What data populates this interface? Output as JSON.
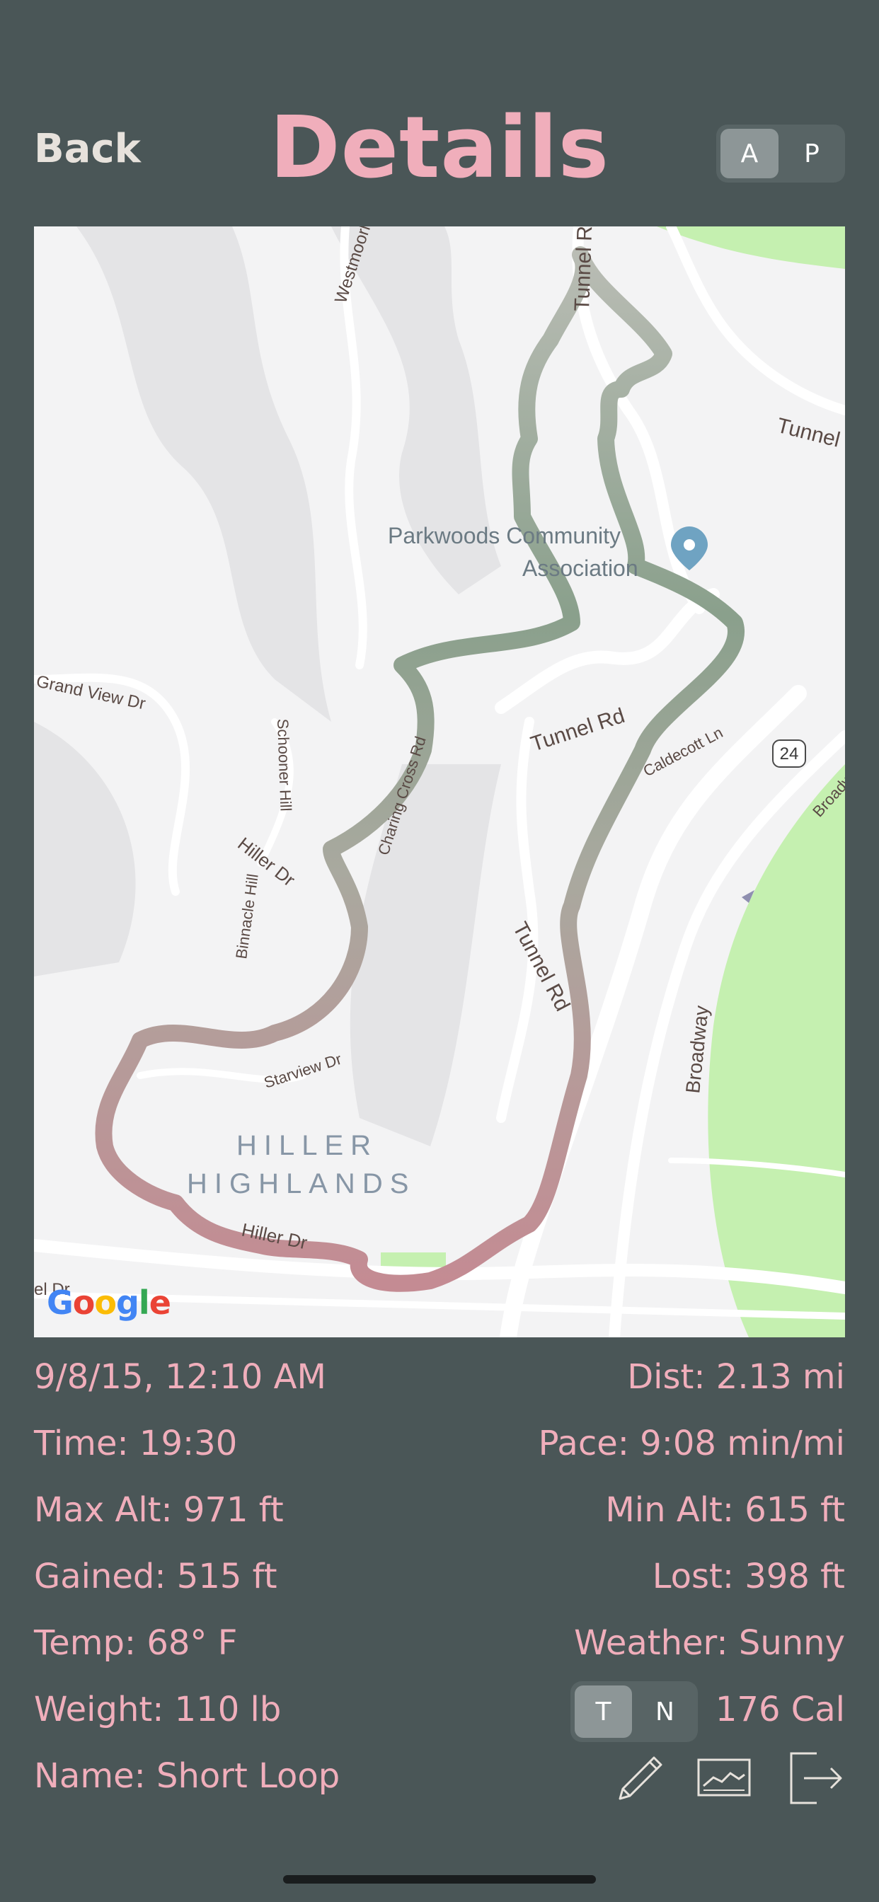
{
  "header": {
    "back_label": "Back",
    "title": "Details",
    "mode_toggle": {
      "options": [
        "A",
        "P"
      ],
      "selected": "A"
    }
  },
  "map": {
    "labels": {
      "westmoorland": "Westmoorland",
      "tunnel_rd_top": "Tunnel Rd",
      "tunnel_right": "Tunnel Rd",
      "poi_line1": "Parkwoods Community",
      "poi_line2": "Association",
      "grand_view": "Grand View Dr",
      "schooner": "Schooner Hill",
      "charing": "Charing Cross Rd",
      "tunnel_mid": "Tunnel Rd",
      "caldecott": "Caldecott Ln",
      "route_24": "24",
      "broadway_top": "Broadway",
      "hiller_dr_mid": "Hiller Dr",
      "binnacle": "Binnacle Hill",
      "tunnel_lower": "Tunnel Rd",
      "broadway": "Broadway",
      "starview": "Starview Dr",
      "area_line1": "HILLER",
      "area_line2": "HIGHLANDS",
      "hiller_dr_bottom": "Hiller Dr",
      "edge_text": "el Dr"
    },
    "attribution": "Google",
    "colors": {
      "route_start": "#8aa08c",
      "route_end": "#c48b93",
      "park": "#c5f0b0",
      "land": "#f3f3f4"
    }
  },
  "stats": {
    "datetime": "9/8/15, 12:10 AM",
    "distance": "Dist: 2.13 mi",
    "time": "Time: 19:30",
    "pace": "Pace: 9:08 min/mi",
    "max_alt": "Max Alt: 971 ft",
    "min_alt": "Min Alt: 615 ft",
    "gained": "Gained: 515 ft",
    "lost": "Lost: 398 ft",
    "temp": "Temp: 68° F",
    "weather": "Weather: Sunny",
    "weight": "Weight: 110 lb",
    "calories": "176 Cal",
    "name": "Name: Short Loop",
    "unit_toggle": {
      "options": [
        "T",
        "N"
      ],
      "selected": "T"
    }
  },
  "actions": [
    "pencil-icon",
    "chart-icon",
    "export-icon"
  ],
  "colors": {
    "background": "#4a5657",
    "accent": "#f0aebb",
    "back_text": "#e7e2dc"
  }
}
